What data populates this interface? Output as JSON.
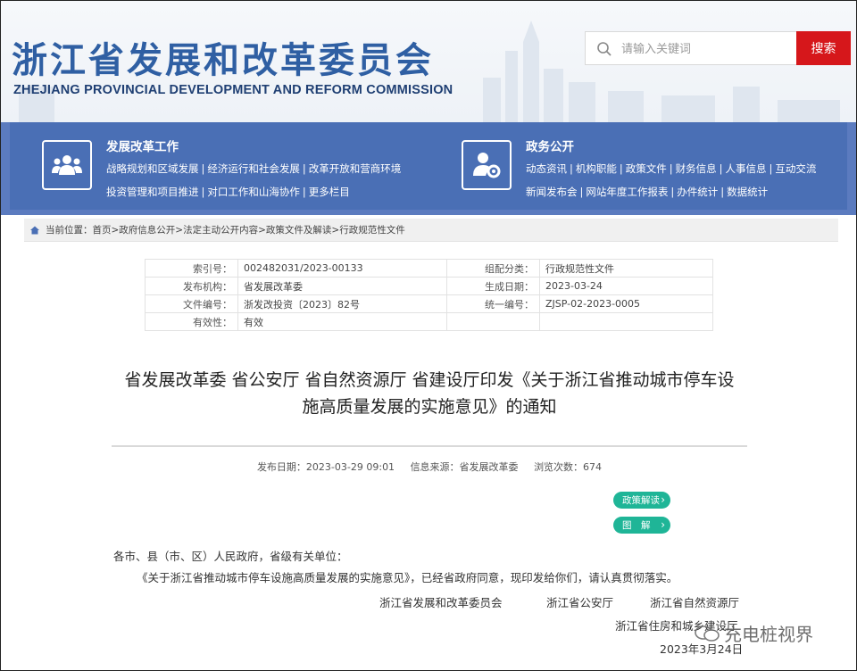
{
  "header": {
    "org_cn": "浙江省发展和改革委员会",
    "org_en": "ZHEJIANG PROVINCIAL DEVELOPMENT AND REFORM COMMISSION",
    "search_placeholder": "请输入关键词",
    "search_button": "搜索",
    "brand_color": "#2f5fa3",
    "search_button_color": "#d6171b"
  },
  "nav": {
    "left": {
      "title": "发展改革工作",
      "icon": "people-group-icon",
      "line1": [
        "战略规划和区域发展",
        "经济运行和社会发展",
        "改革开放和营商环境"
      ],
      "line2": [
        "投资管理和项目推进",
        "对口工作和山海协作",
        "更多栏目"
      ]
    },
    "right": {
      "title": "政务公开",
      "icon": "user-gear-icon",
      "line1": [
        "动态资讯",
        "机构职能",
        "政策文件",
        "财务信息",
        "人事信息",
        "互动交流"
      ],
      "line2": [
        "新闻发布会",
        "网站年度工作报表",
        "办件统计",
        "数据统计"
      ]
    },
    "band_color": "#4a6fb5"
  },
  "breadcrumb": {
    "label": "当前位置：",
    "path": "首页>政府信息公开>法定主动公开内容>政策文件及解读>行政规范性文件"
  },
  "meta": {
    "rows": [
      {
        "k1": "索引号：",
        "v1": "002482031/2023-00133",
        "k2": "组配分类：",
        "v2": "行政规范性文件"
      },
      {
        "k1": "发布机构：",
        "v1": "省发展改革委",
        "k2": "生成日期：",
        "v2": "2023-03-24"
      },
      {
        "k1": "文件编号：",
        "v1": "浙发改投资〔2023〕82号",
        "k2": "统一编号：",
        "v2": "ZJSP-02-2023-0005"
      },
      {
        "k1": "有效性：",
        "v1": "有效",
        "k2": "",
        "v2": ""
      }
    ]
  },
  "document": {
    "title_line1": "省发展改革委 省公安厅 省自然资源厅 省建设厅印发《关于浙江省推动城市停车设",
    "title_line2": "施高质量发展的实施意见》的通知",
    "publish_date": "发布日期：2023-03-29 09:01",
    "source": "信息来源：省发展改革委",
    "views": "浏览次数：674",
    "pill_policy": "政策解读",
    "pill_graphic": "图　解",
    "greeting": "各市、县（市、区）人民政府，省级有关单位：",
    "paragraph": "《关于浙江省推动城市停车设施高质量发展的实施意见》，已经省政府同意，现印发给你们，请认真贯彻落实。",
    "signers_line1": [
      "浙江省发展和改革委员会",
      "浙江省公安厅",
      "浙江省自然资源厅"
    ],
    "signer_line2": "浙江省住房和城乡建设厅",
    "sign_date": "2023年3月24日",
    "pill_color": "#1fb597"
  },
  "watermark": {
    "text": "充电桩视界",
    "icon": "wechat-icon"
  }
}
